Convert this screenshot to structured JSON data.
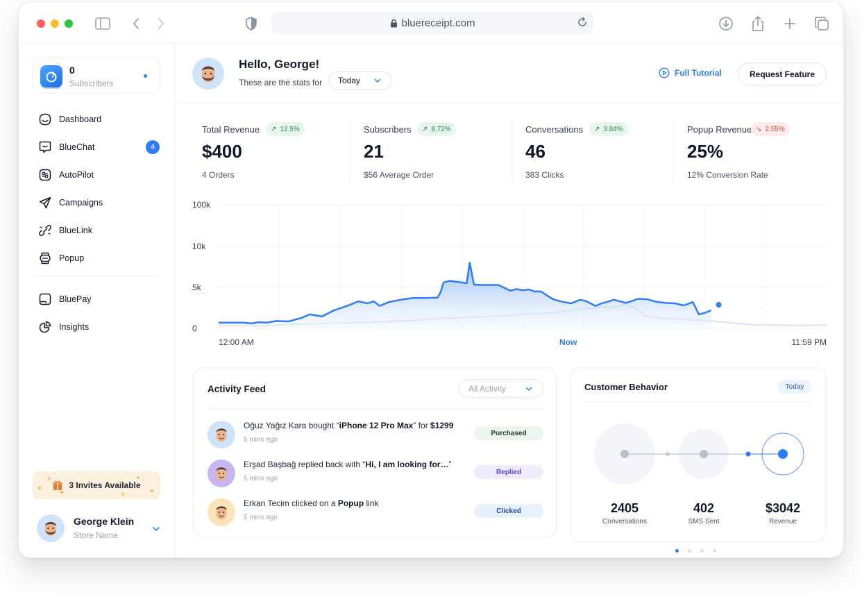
{
  "browser": {
    "url": "bluereceipt.com"
  },
  "brand": {
    "count": "0",
    "label": "Subscribers"
  },
  "sidebar": {
    "items": [
      {
        "label": "Dashboard",
        "icon": "dashboard-icon"
      },
      {
        "label": "BlueChat",
        "icon": "chat-icon",
        "badge": "4"
      },
      {
        "label": "AutoPilot",
        "icon": "autopilot-icon"
      },
      {
        "label": "Campaigns",
        "icon": "send-icon"
      },
      {
        "label": "BlueLink",
        "icon": "link-icon"
      },
      {
        "label": "Popup",
        "icon": "popup-icon"
      },
      {
        "label": "BluePay",
        "icon": "wallet-icon"
      },
      {
        "label": "Insights",
        "icon": "pie-chart-icon"
      }
    ],
    "invites": "3 Invites Available",
    "user": {
      "name": "George Klein",
      "store": "Store Name"
    }
  },
  "header": {
    "greeting": "Hello, George!",
    "stats_for": "These are the stats for",
    "range": "Today",
    "tutorial": "Full Tutorial",
    "request": "Request Feature"
  },
  "stats": [
    {
      "label": "Total Revenue",
      "change": "12.5%",
      "direction": "up",
      "value": "$400",
      "sub": "4 Orders"
    },
    {
      "label": "Subscribers",
      "change": "8.72%",
      "direction": "up",
      "value": "21",
      "sub": "$56 Average Order"
    },
    {
      "label": "Conversations",
      "change": "3.84%",
      "direction": "up",
      "value": "46",
      "sub": "383 Clicks"
    },
    {
      "label": "Popup Revenue",
      "change": "2.55%",
      "direction": "down",
      "value": "25%",
      "sub": "12% Conversion Rate"
    }
  ],
  "chart_data": {
    "type": "area",
    "y_tick_labels": [
      "0",
      "5k",
      "10k",
      "100k"
    ],
    "x_tick_labels": [
      "12:00 AM",
      "Now",
      "11:59 PM"
    ],
    "x_range": [
      0,
      100
    ],
    "now_x": 57.5,
    "series": [
      {
        "style": "area",
        "x": [
          0,
          2,
          4,
          5.5,
          6.5,
          8,
          9.5,
          11.5,
          13.5,
          15,
          17,
          19,
          21,
          23,
          24.5,
          25.5,
          26.5,
          28,
          30,
          32,
          34,
          36,
          36.5,
          37,
          38,
          40,
          40.8,
          41.3,
          42,
          43,
          46,
          48,
          49,
          50,
          51,
          52,
          53,
          55,
          56.5,
          58,
          59.5,
          60.5,
          62,
          63,
          64,
          65,
          67,
          69,
          70.5,
          72,
          73.5,
          75,
          76.5,
          78,
          79,
          80,
          81
        ],
        "y": [
          0.7,
          0.7,
          0.7,
          0.6,
          0.75,
          0.7,
          0.9,
          0.85,
          1.25,
          1.7,
          1.45,
          2.2,
          2.7,
          3.3,
          3.05,
          3.3,
          2.75,
          3.2,
          3.5,
          3.7,
          3.7,
          3.75,
          4.4,
          5.6,
          5.8,
          5.6,
          5.5,
          8.0,
          5.35,
          5.3,
          5.3,
          4.6,
          4.8,
          4.65,
          4.75,
          4.5,
          4.5,
          3.55,
          3.25,
          3.05,
          3.5,
          3.3,
          2.75,
          3.05,
          3.25,
          3.5,
          3.1,
          3.6,
          3.55,
          3.25,
          3.1,
          3.05,
          2.8,
          3.2,
          1.7,
          1.9,
          2.2
        ]
      },
      {
        "style": "line",
        "x": [
          0,
          3,
          6,
          9,
          12,
          15,
          18,
          21,
          24,
          27,
          30,
          33,
          36,
          39,
          42,
          45,
          48,
          51,
          54,
          57,
          58.5,
          60,
          61.5,
          63,
          64.5,
          66,
          66.8,
          67.5,
          68.5,
          70,
          71.5,
          73,
          76,
          80,
          84,
          88,
          92,
          96,
          100
        ],
        "y": [
          0.35,
          0.35,
          0.3,
          0.35,
          0.5,
          0.55,
          0.6,
          0.65,
          0.7,
          0.8,
          0.9,
          1.0,
          1.2,
          1.25,
          1.4,
          1.45,
          1.6,
          1.75,
          1.85,
          2.1,
          2.2,
          2.4,
          2.5,
          2.6,
          2.55,
          2.7,
          2.95,
          2.65,
          2.55,
          1.55,
          1.35,
          1.2,
          1.1,
          0.95,
          0.7,
          0.4,
          0.4,
          0.35,
          0.4
        ]
      }
    ],
    "y_axis": "0 / 5k / 10k / 100k, non-linear",
    "grid": "horizontal solid, vertical dashed",
    "colors": {
      "primary": "#2f7cf6",
      "secondary": "#dde3f3"
    }
  },
  "activity": {
    "title": "Activity Feed",
    "filter": "All Activity",
    "rows": [
      {
        "pre": "Oğuz Yağız Kara bought “",
        "bold1": "iPhone 12 Pro Max",
        "mid": "” for ",
        "bold2": "$1299",
        "post": "",
        "time": "5 mins ago",
        "status": "Purchased",
        "kind": "purchased",
        "avatar_bg": "#cfe3fb"
      },
      {
        "pre": "Erşad Başbağ replied back with “",
        "bold1": "Hi, I am looking for…",
        "mid": "”",
        "bold2": "",
        "post": "",
        "time": "5 mins ago",
        "status": "Replied",
        "kind": "replied",
        "avatar_bg": "#c9b6f0"
      },
      {
        "pre": "Erkan Tecim clicked on a ",
        "bold1": "Popup",
        "mid": " link",
        "bold2": "",
        "post": "",
        "time": "5 mins ago",
        "status": "Clicked",
        "kind": "clicked",
        "avatar_bg": "#fde4b8"
      }
    ]
  },
  "behavior": {
    "title": "Customer Behavior",
    "range": "Today",
    "metrics": [
      {
        "value": "2405",
        "label": "Conversations"
      },
      {
        "value": "402",
        "label": "SMS Sent"
      },
      {
        "value": "$3042",
        "label": "Revenue"
      }
    ]
  },
  "colors": {
    "accent": "#2f7cf6",
    "up": "#1c8b43",
    "down": "#d0473a"
  }
}
